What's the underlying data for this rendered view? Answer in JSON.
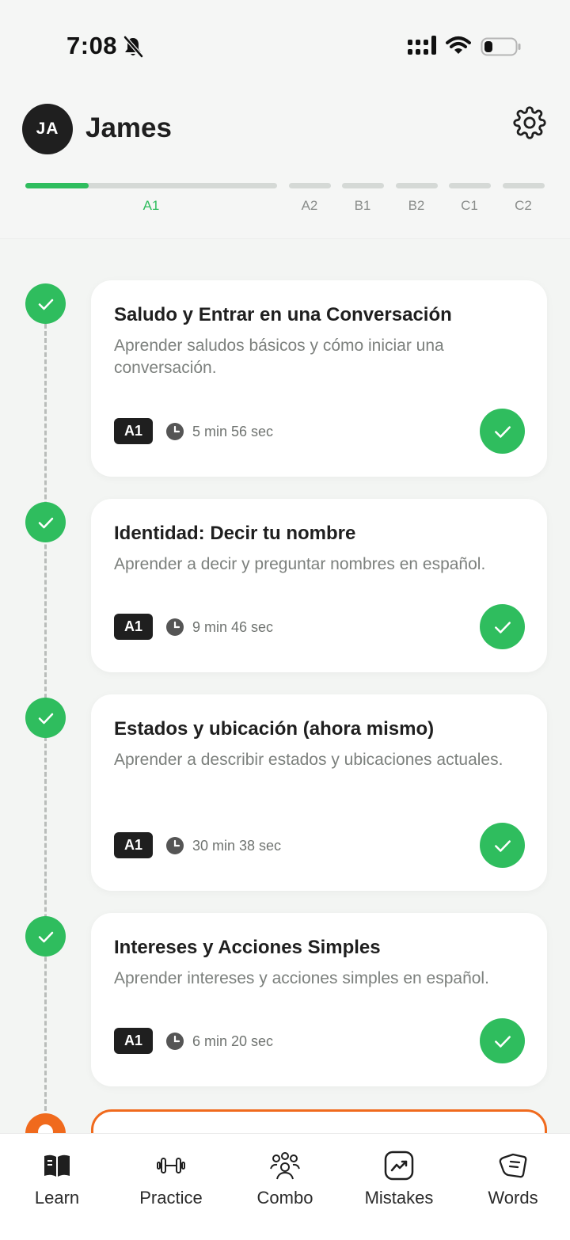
{
  "status_bar": {
    "time": "7:08"
  },
  "header": {
    "avatar_initials": "JA",
    "user_name": "James",
    "levels": [
      {
        "label": "A1",
        "progress": 0.25,
        "active": true
      },
      {
        "label": "A2",
        "progress": 0
      },
      {
        "label": "B1",
        "progress": 0
      },
      {
        "label": "B2",
        "progress": 0
      },
      {
        "label": "C1",
        "progress": 0
      },
      {
        "label": "C2",
        "progress": 0
      }
    ]
  },
  "lessons": [
    {
      "title": "Saludo y Entrar en una Conversación",
      "description": "Aprender saludos básicos y cómo iniciar una conversación.",
      "level": "A1",
      "duration": "5 min 56 sec",
      "completed": true
    },
    {
      "title": "Identidad: Decir tu nombre",
      "description": "Aprender a decir y preguntar nombres en español.",
      "level": "A1",
      "duration": "9 min 46 sec",
      "completed": true
    },
    {
      "title": "Estados y ubicación (ahora mismo)",
      "description": "Aprender a describir estados y ubicaciones actuales.",
      "level": "A1",
      "duration": "30 min 38 sec",
      "completed": true
    },
    {
      "title": "Intereses y Acciones Simples",
      "description": "Aprender intereses y acciones simples en español.",
      "level": "A1",
      "duration": "6 min 20 sec",
      "completed": true
    }
  ],
  "nav": {
    "learn": "Learn",
    "practice": "Practice",
    "combo": "Combo",
    "mistakes": "Mistakes",
    "words": "Words"
  },
  "colors": {
    "accent_green": "#2fbd5e",
    "accent_orange": "#f06a1d",
    "dark": "#1f1f1f"
  }
}
